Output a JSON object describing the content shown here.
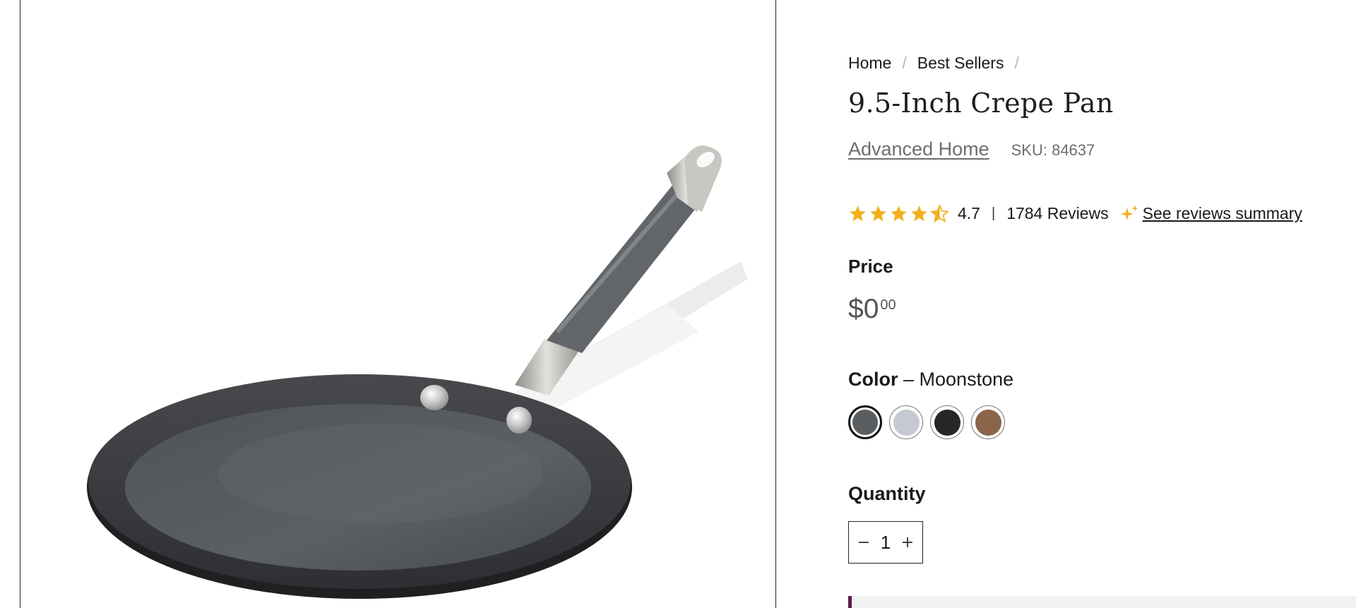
{
  "breadcrumb": {
    "home": "Home",
    "best_sellers": "Best Sellers",
    "separator": "/"
  },
  "product": {
    "title": "9.5-Inch Crepe Pan",
    "brand": "Advanced Home",
    "sku": "SKU: 84637",
    "image_alt": "crepe-pan-product-image"
  },
  "rating": {
    "value": "4.7",
    "stars_value": 4.7,
    "stars_max": 5,
    "divider": "|",
    "reviews": "1784 Reviews",
    "summary_link": "See reviews summary",
    "star_color": "#f2b01e"
  },
  "price": {
    "label": "Price",
    "main": "$0",
    "cents": "00"
  },
  "color": {
    "label": "Color",
    "dash": " – ",
    "selected": "Moonstone",
    "swatches": [
      {
        "name": "Moonstone",
        "color": "#5b5e60",
        "selected": true
      },
      {
        "name": "silver",
        "color": "#c6c8d2",
        "selected": false
      },
      {
        "name": "black",
        "color": "#262626",
        "selected": false
      },
      {
        "name": "bronze",
        "color": "#8a654a",
        "selected": false
      }
    ]
  },
  "quantity": {
    "label": "Quantity",
    "value": "1",
    "minus": "−",
    "plus": "+"
  },
  "colors": {
    "accent": "#5c1a4a",
    "text_muted": "#6e6e6e"
  }
}
